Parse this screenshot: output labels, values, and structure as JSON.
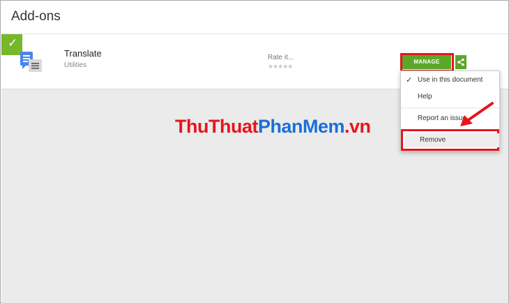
{
  "header": {
    "title": "Add-ons"
  },
  "addon": {
    "name": "Translate",
    "category": "Utilities",
    "rate_label": "Rate it...",
    "stars": "★★★★★",
    "rating": 0,
    "manage_label": "MANAGE",
    "installed_icon": "check-icon",
    "icon": "translate-app-icon"
  },
  "menu": {
    "items": [
      {
        "label": "Use in this document",
        "checked": true
      },
      {
        "label": "Help"
      },
      {
        "label": "Report an issue"
      },
      {
        "label": "Remove"
      }
    ]
  },
  "watermark": {
    "part1": "ThuThuat",
    "part2": "PhanMem",
    "part3": ".vn"
  },
  "colors": {
    "accent_green": "#5ca72a",
    "highlight_red": "#e8141c",
    "watermark_blue": "#1b6fd8"
  }
}
